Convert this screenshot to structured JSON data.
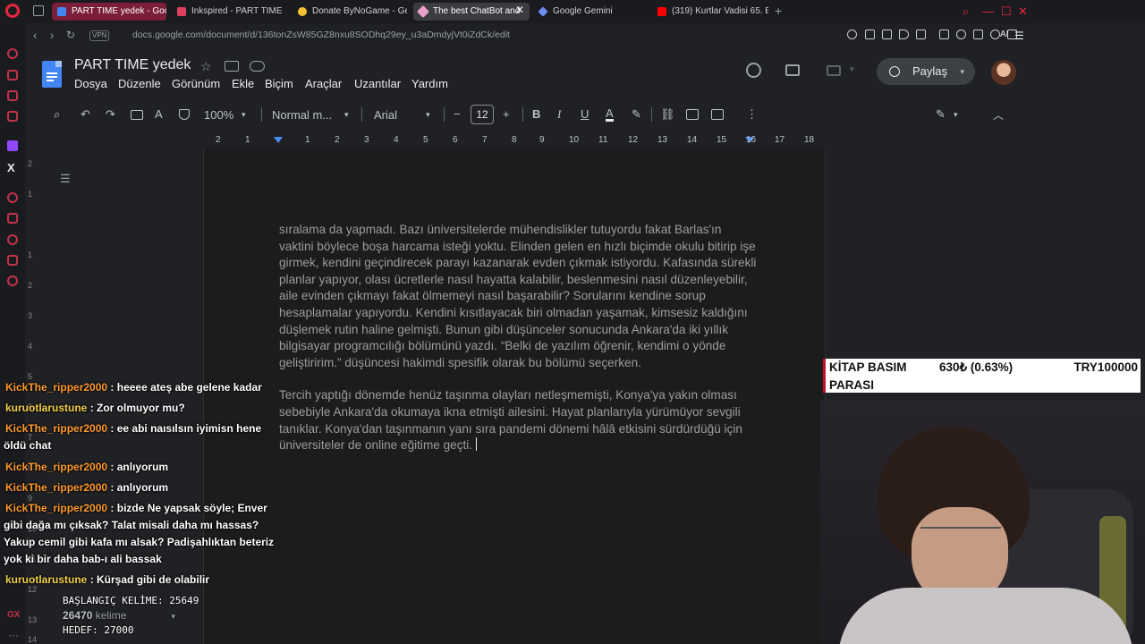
{
  "browser": {
    "tabs": [
      {
        "label": "PART TIME yedek - Google",
        "state": "pink"
      },
      {
        "label": "Inkspired - PART TIME",
        "state": "normal"
      },
      {
        "label": "Donate ByNoGame - Gele",
        "state": "normal"
      },
      {
        "label": "The best ChatBot and",
        "state": "active"
      },
      {
        "label": "Google Gemini",
        "state": "normal"
      },
      {
        "label": "(319) Kurtlar Vadisi 65. Bö",
        "state": "normal"
      }
    ],
    "vpn_label": "VPN",
    "url": "docs.google.com/document/d/136tonZsW85GZ8nxu8SODhq29ey_u3aDmdyjVt0iZdCk/edit",
    "ai_label": "AI"
  },
  "docs": {
    "title": "PART TIME  yedek",
    "menu": [
      "Dosya",
      "Düzenle",
      "Görünüm",
      "Ekle",
      "Biçim",
      "Araçlar",
      "Uzantılar",
      "Yardım"
    ],
    "share_label": "Paylaş",
    "toolbar": {
      "zoom": "100%",
      "style": "Normal m...",
      "font": "Arial",
      "font_size": "12"
    },
    "ruler": [
      "2",
      "1",
      "1",
      "2",
      "3",
      "4",
      "5",
      "6",
      "7",
      "8",
      "9",
      "10",
      "11",
      "12",
      "13",
      "14",
      "15",
      "16",
      "17",
      "18"
    ],
    "vruler": [
      "2",
      "1",
      "1",
      "2",
      "3",
      "4",
      "5",
      "6",
      "7",
      "8",
      "9",
      "10",
      "11",
      "12",
      "13",
      "14"
    ],
    "paragraphs": [
      "sıralama da yapmadı. Bazı üniversitelerde mühendislikler tutuyordu fakat Barlas'ın vaktini böylece boşa harcama isteği yoktu. Elinden gelen en hızlı biçimde okulu bitirip işe girmek, kendini geçindirecek parayı kazanarak evden çıkmak istiyordu. Kafasında sürekli planlar yapıyor, olası ücretlerle nasıl hayatta kalabilir, beslenmesini nasıl düzenleyebilir, aile evinden çıkmayı fakat ölmemeyi nasıl başarabilir? Sorularını kendine sorup hesaplamalar yapıyordu. Kendini kısıtlayacak biri olmadan yaşamak, kimsesiz kaldığını düşlemek rutin haline gelmişti. Bunun gibi düşünceler sonucunda Ankara'da iki yıllık bilgisayar programcılığı bölümünü yazdı. “Belki de yazılım öğrenir, kendimi o yönde geliştiririm.” düşüncesi hakimdi spesifik olarak bu bölümü seçerken.",
      "Tercih yaptığı dönemde henüz taşınma olayları netleşmemişti, Konya'ya yakın olması sebebiyle Ankara'da okumaya ikna etmişti ailesini. Hayat planlarıyla yürümüyor sevgili tanıklar. Konya'dan taşınmanın yanı sıra pandemi dönemi hâlâ etkisini sürdürdüğü için üniversiteler de online eğitime geçti."
    ]
  },
  "chat": [
    {
      "user": "KickThe_ripper2000",
      "text": ": heeee ateş abe gelene kadar",
      "color": "#ff9b2f"
    },
    {
      "user": "kuruotlarustune",
      "text": ": Zor olmuyor mu?",
      "color": "#f2d04a"
    },
    {
      "user": "KickThe_ripper2000",
      "text": ": ee abi naısılsın iyimisn hene öldü chat",
      "color": "#ff9b2f"
    },
    {
      "user": "KickThe_ripper2000",
      "text": ": anlıyorum",
      "color": "#ff9b2f"
    },
    {
      "user": "KickThe_ripper2000",
      "text": ": anlıyorum",
      "color": "#ff9b2f"
    },
    {
      "user": "KickThe_ripper2000",
      "text": ": bizde Ne yapsak söyle; Enver gibi dağa mı çıksak? Talat misali daha mı hassas? Yakup cemil gibi kafa mı alsak? Padişahlıktan beteriz yok ki bir daha bab-ı ali bassak",
      "color": "#ff9b2f"
    },
    {
      "user": "kuruotlarustune",
      "text": ": Kürşad gibi de olabilir",
      "color": "#f2d04a"
    }
  ],
  "counter": {
    "start": "BAŞLANGIÇ KELİME: 25649",
    "word_count_num": "26470",
    "word_count_unit": " kelime",
    "target": "HEDEF: 27000"
  },
  "ticker": {
    "line1": "KİTAP BASIM",
    "amount": "630₺ (0.63%)",
    "goal": "TRY100000",
    "line2": "PARASI"
  },
  "colors": {
    "opera_red": "#e8263d",
    "docs_blue": "#4285f4",
    "chat_orange": "#ff9b2f",
    "chat_yellow": "#f2d04a"
  }
}
